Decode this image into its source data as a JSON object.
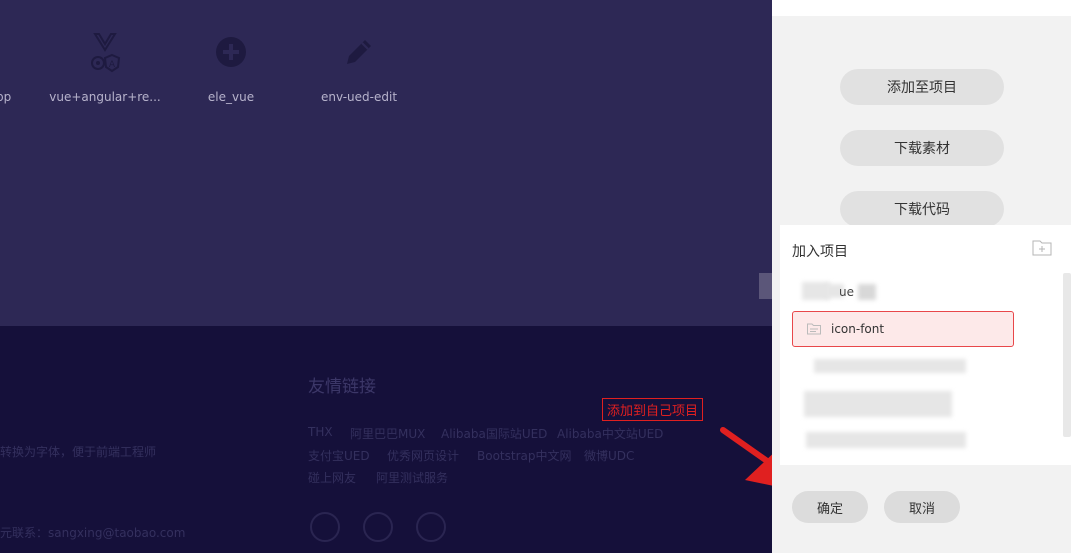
{
  "background": {
    "icons": [
      {
        "name": "app",
        "icon": "app-icon"
      },
      {
        "name": "vue+angular+re...",
        "icon": "vue-angular-icon"
      },
      {
        "name": "ele_vue",
        "icon": "plus-circle-icon"
      },
      {
        "name": "env-ued-edit",
        "icon": "pencil-icon"
      }
    ],
    "footer": {
      "friend_title": "友情链接",
      "links": [
        "THX",
        "阿里巴巴MUX",
        "Alibaba国际站UED",
        "Alibaba中文站UED",
        "支付宝UED",
        "优秀网页设计",
        "Bootstrap中文网",
        "微博UDC",
        "碰上网友",
        "阿里测试服务"
      ],
      "desc": "转换为字体，便于前端工程师",
      "contact": "元联系：sangxing@taobao.com"
    }
  },
  "annotation": {
    "label": "添加到自己项目",
    "color": "#e02020"
  },
  "panel": {
    "buttons": {
      "add_to_project": "添加至项目",
      "download_material": "下载素材",
      "download_code": "下载代码"
    },
    "project_section_title": "加入项目",
    "projects": [
      {
        "label": "ue",
        "selected": false
      },
      {
        "label": "icon-font",
        "selected": true
      }
    ],
    "confirm_label": "确定",
    "cancel_label": "取消",
    "accent": "#e8474a"
  }
}
